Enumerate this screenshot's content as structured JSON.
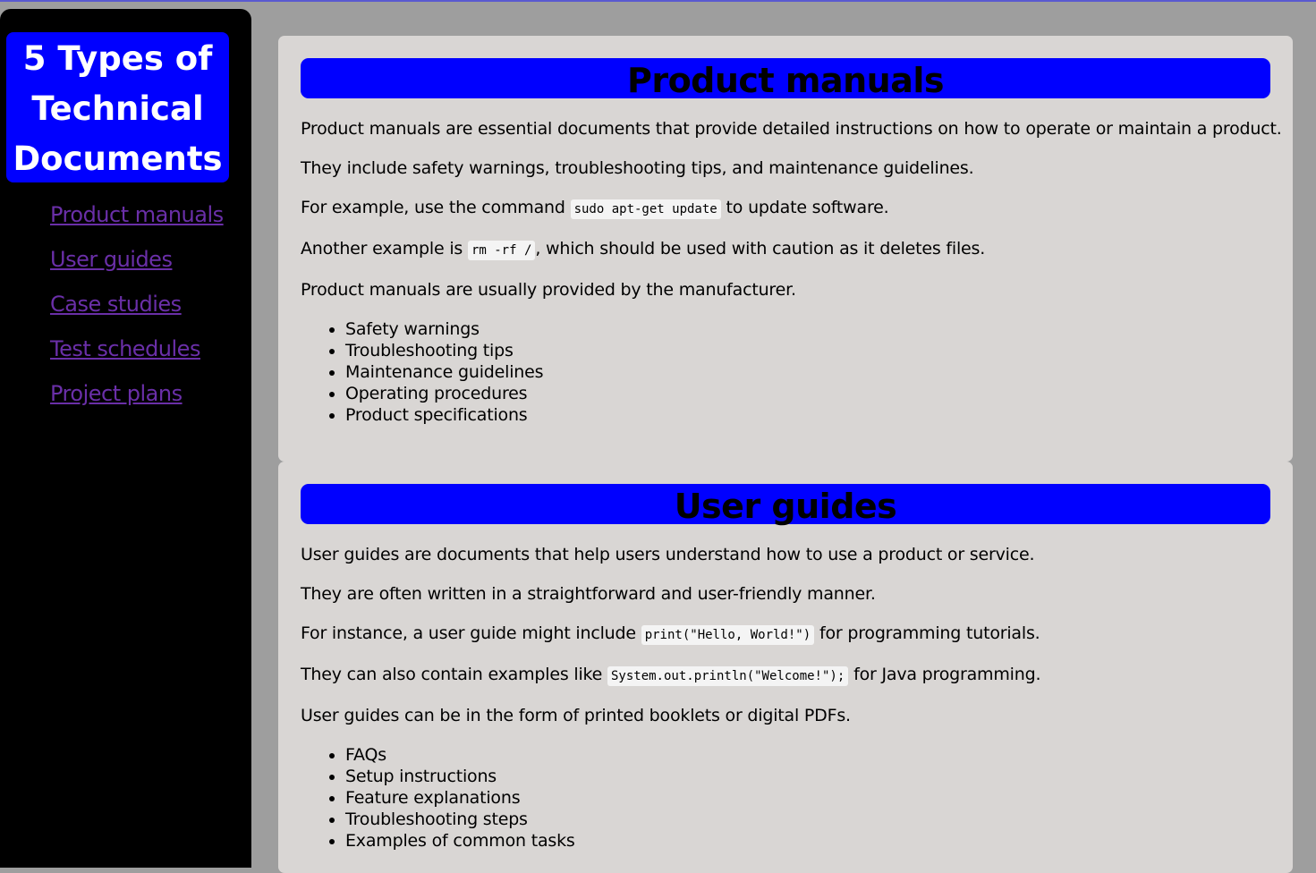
{
  "sidebar": {
    "title": "5 Types of Technical Documents",
    "nav": [
      {
        "label": "Product manuals"
      },
      {
        "label": "User guides"
      },
      {
        "label": "Case studies"
      },
      {
        "label": "Test schedules"
      },
      {
        "label": "Project plans"
      }
    ]
  },
  "sections": [
    {
      "heading": "Product manuals",
      "p1": "Product manuals are essential documents that provide detailed instructions on how to operate or maintain a product.",
      "p2": "They include safety warnings, troubleshooting tips, and maintenance guidelines.",
      "p3_before": "For example, use the command ",
      "p3_code": "sudo apt-get update",
      "p3_after": " to update software.",
      "p4_before": "Another example is ",
      "p4_code": "rm -rf /",
      "p4_after": ", which should be used with caution as it deletes files.",
      "p5": "Product manuals are usually provided by the manufacturer.",
      "list": [
        "Safety warnings",
        "Troubleshooting tips",
        "Maintenance guidelines",
        "Operating procedures",
        "Product specifications"
      ]
    },
    {
      "heading": "User guides",
      "p1": "User guides are documents that help users understand how to use a product or service.",
      "p2": "They are often written in a straightforward and user-friendly manner.",
      "p3_before": "For instance, a user guide might include ",
      "p3_code": "print(\"Hello, World!\")",
      "p3_after": " for programming tutorials.",
      "p4_before": "They can also contain examples like ",
      "p4_code": "System.out.println(\"Welcome!\");",
      "p4_after": " for Java programming.",
      "p5": "User guides can be in the form of printed booklets or digital PDFs.",
      "list": [
        "FAQs",
        "Setup instructions",
        "Feature explanations",
        "Troubleshooting steps",
        "Examples of common tasks"
      ]
    }
  ],
  "colors": {
    "accent": "#0000ff",
    "page_bg": "#9e9e9e",
    "card_bg": "#d9d6d4",
    "link": "#6a2fa8"
  }
}
